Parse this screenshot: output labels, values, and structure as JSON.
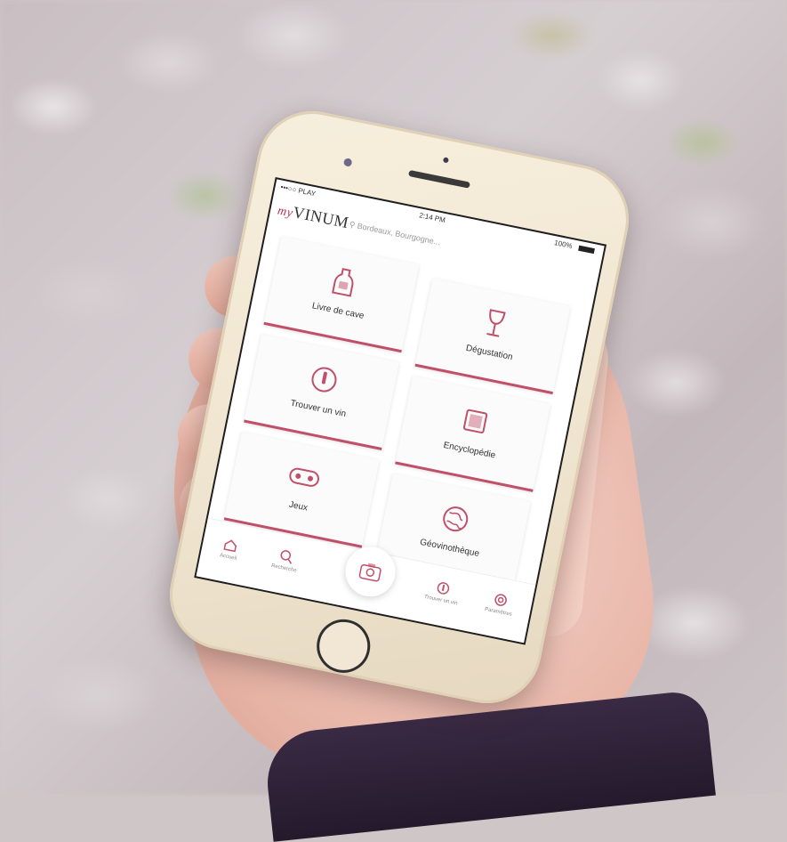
{
  "status_bar": {
    "carrier": "•••○○ PLAY",
    "wifi_icon": "wifi-icon",
    "time": "2:14 PM",
    "battery": "100%"
  },
  "header": {
    "logo_prefix": "my",
    "logo_main": "VINUM",
    "search_placeholder": "Bordeaux, Bourgogne..."
  },
  "tiles": [
    {
      "label": "Livre de cave",
      "icon": "bottle-icon"
    },
    {
      "label": "Dégustation",
      "icon": "wine-glass-icon"
    },
    {
      "label": "Trouver un vin",
      "icon": "compass-icon"
    },
    {
      "label": "Encyclopédie",
      "icon": "book-icon"
    },
    {
      "label": "Jeux",
      "icon": "gamepad-icon"
    },
    {
      "label": "Géovinothèque",
      "icon": "globe-icon"
    }
  ],
  "tabbar": [
    {
      "label": "Accueil",
      "icon": "home-icon"
    },
    {
      "label": "Recherche",
      "icon": "search-icon"
    },
    {
      "label": "",
      "icon": "camera-icon"
    },
    {
      "label": "Trouver un vin",
      "icon": "compass-icon"
    },
    {
      "label": "Paramètres",
      "icon": "settings-icon"
    }
  ],
  "colors": {
    "accent": "#c0506a",
    "phone_body": "#efe4cf",
    "screen_bg": "#ffffff"
  }
}
